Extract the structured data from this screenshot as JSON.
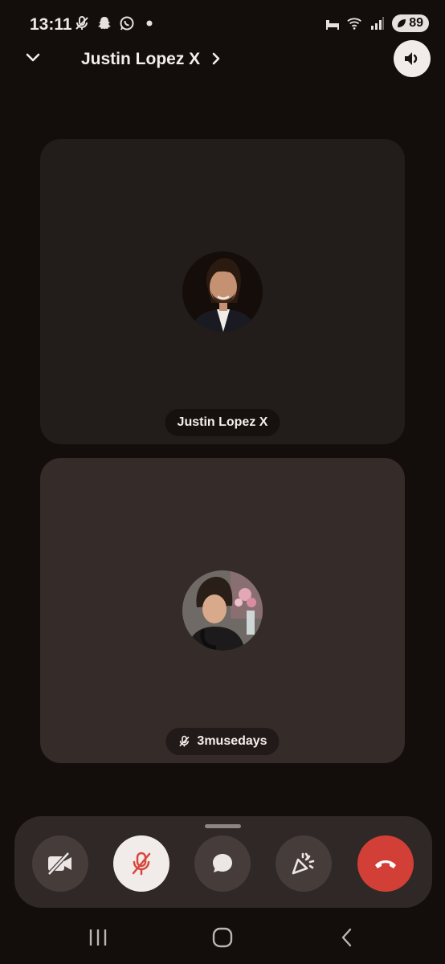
{
  "status_bar": {
    "time": "13:11",
    "battery": "89",
    "left_icons": [
      "mic-off-icon",
      "snapchat-icon",
      "whatsapp-icon",
      "dot-icon"
    ],
    "right_icons": [
      "sleep-icon",
      "wifi-icon",
      "signal-icon"
    ]
  },
  "header": {
    "title": "Justin Lopez X",
    "icons": [
      "chevron-down-icon",
      "chevron-right-icon",
      "speaker-icon"
    ]
  },
  "participants": [
    {
      "name": "Justin Lopez X",
      "muted": false,
      "avatar": "avatar-justin"
    },
    {
      "name": "3musedays",
      "muted": true,
      "avatar": "avatar-3musedays"
    }
  ],
  "controls": {
    "buttons": [
      "camera-off",
      "microphone-muted",
      "chat",
      "soundboard-effects",
      "end-call"
    ],
    "colors": {
      "end_call": "#d23f36",
      "muted_icon": "#d7473d",
      "bar_bg": "#2f2826"
    }
  },
  "nav_bar": {
    "buttons": [
      "recents",
      "home",
      "back"
    ]
  },
  "colors": {
    "background": "#130e0c",
    "tile_1": "#221d1b",
    "tile_2": "#352b29"
  }
}
